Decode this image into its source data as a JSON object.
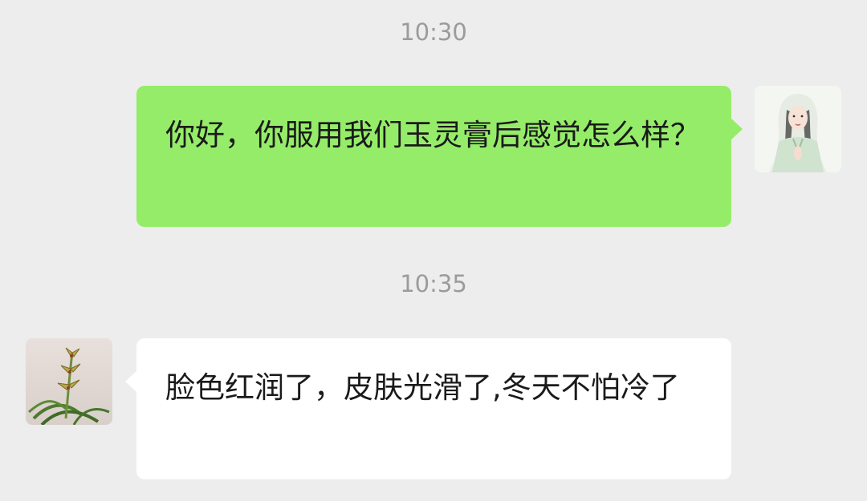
{
  "chat": {
    "messages": [
      {
        "timestamp": "10:30",
        "sender": "self",
        "text": "你好，你服用我们玉灵膏后感觉怎么样？",
        "avatar_icon": "woman-portrait-avatar"
      },
      {
        "timestamp": "10:35",
        "sender": "other",
        "text": "脸色红润了，皮肤光滑了,冬天不怕冷了",
        "avatar_icon": "orchid-plant-avatar"
      }
    ]
  },
  "colors": {
    "background": "#ededed",
    "sent_bubble": "#95ec69",
    "received_bubble": "#ffffff",
    "timestamp_text": "#9b9b9b",
    "message_text": "#1a1a1a"
  }
}
